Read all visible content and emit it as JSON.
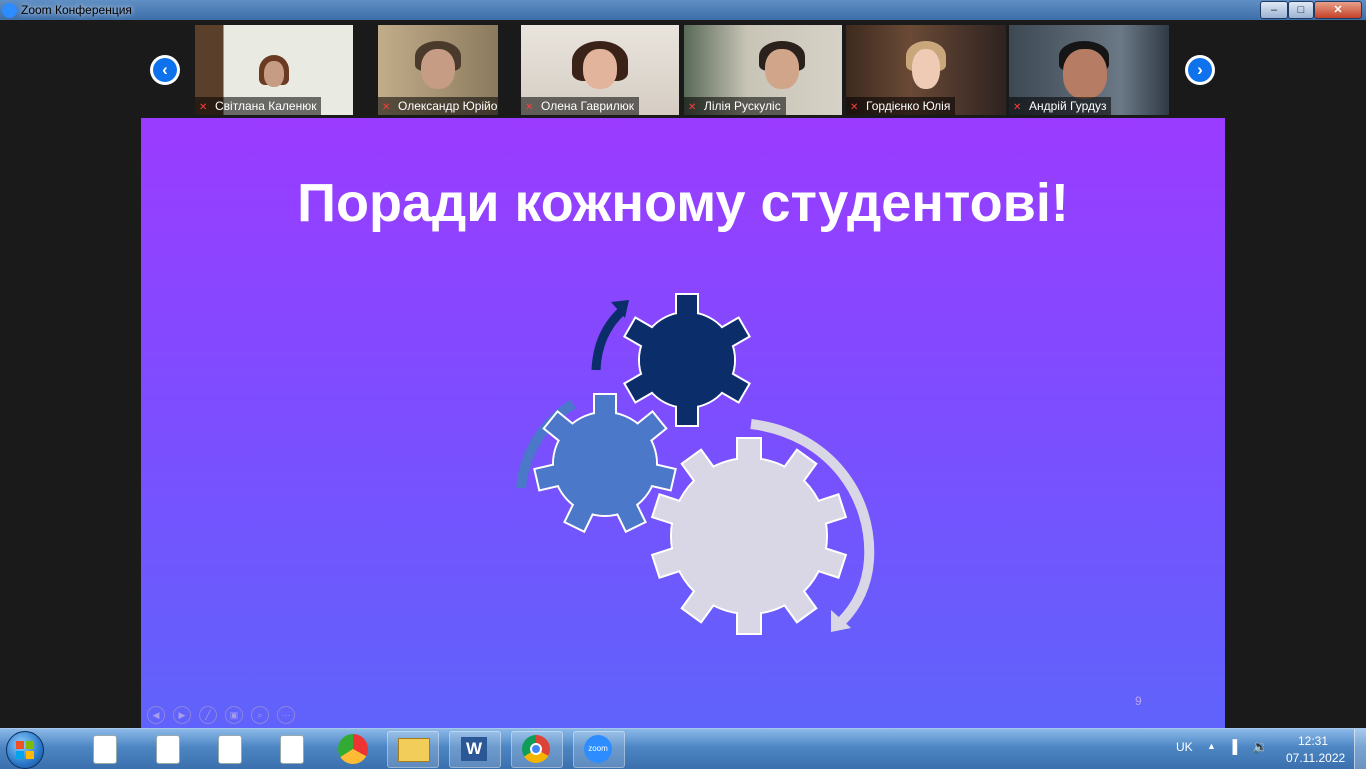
{
  "window": {
    "title": "Zoom Конференция",
    "buttons": [
      "minimize",
      "restore",
      "close"
    ]
  },
  "participants": [
    {
      "name": "Світлана Каленюк",
      "mic": "muted"
    },
    {
      "name": "Олександр Юрійович",
      "mic": "muted"
    },
    {
      "name": "Олена Гаврилюк",
      "mic": "muted"
    },
    {
      "name": "Лілія Рускуліс",
      "mic": "muted"
    },
    {
      "name": "Гордієнко Юлія",
      "mic": "muted"
    },
    {
      "name": "Андрій Гурдуз",
      "mic": "muted"
    }
  ],
  "nav": {
    "prev_icon": "chevron-left-icon",
    "next_icon": "chevron-right-icon"
  },
  "slide": {
    "title": "Поради кожному студентові!",
    "page_number": "9",
    "colors": {
      "top": "#9b3bff",
      "bottom": "#5f63fb",
      "gear_dark": "#0b2e6b",
      "gear_mid": "#4b78c8",
      "gear_light": "#d9d7e6"
    }
  },
  "taskbar": {
    "language": "UK",
    "time": "12:31",
    "date": "07.11.2022",
    "apps": [
      "explorer",
      "word",
      "chrome",
      "zoom"
    ]
  }
}
